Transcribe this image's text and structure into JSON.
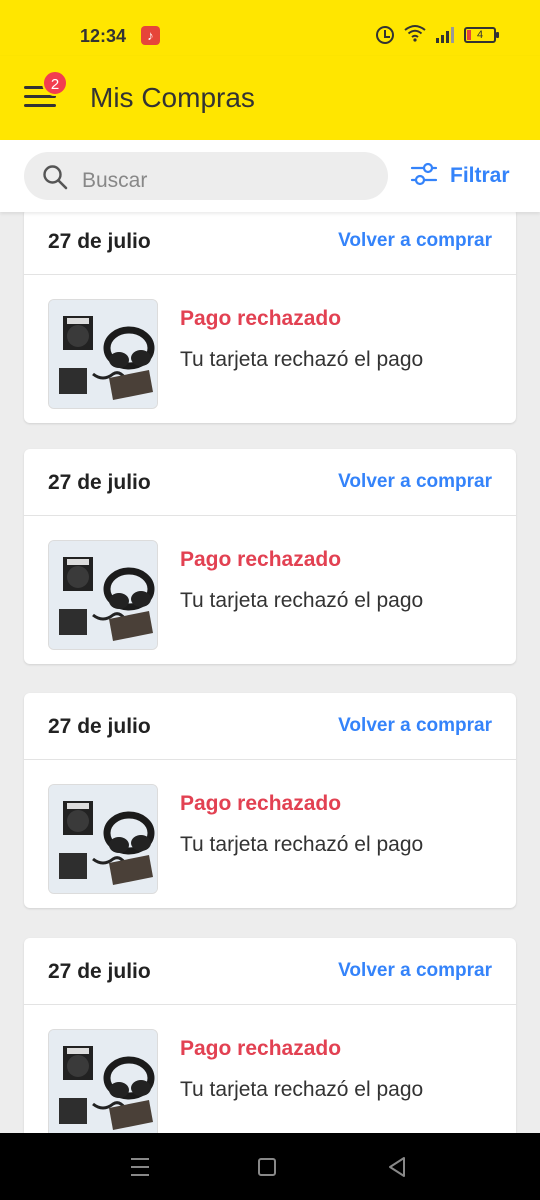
{
  "status_bar": {
    "time": "12:34",
    "battery_level": "4",
    "notification_app": "music-app-icon",
    "icons": [
      "alarm-icon",
      "wifi-icon",
      "signal-icon",
      "battery-icon"
    ]
  },
  "header": {
    "title": "Mis Compras",
    "menu_badge": "2",
    "background_color": "#ffe600"
  },
  "search": {
    "placeholder": "Buscar",
    "filter_label": "Filtrar"
  },
  "colors": {
    "accent": "#3483fa",
    "error": "#e24152"
  },
  "purchases": [
    {
      "date": "27 de julio",
      "action": "Volver a comprar",
      "status": "Pago rechazado",
      "detail": "Tu tarjeta rechazó el pago",
      "image": "headphones-product-image"
    },
    {
      "date": "27 de julio",
      "action": "Volver a comprar",
      "status": "Pago rechazado",
      "detail": "Tu tarjeta rechazó el pago",
      "image": "headphones-product-image"
    },
    {
      "date": "27 de julio",
      "action": "Volver a comprar",
      "status": "Pago rechazado",
      "detail": "Tu tarjeta rechazó el pago",
      "image": "headphones-product-image"
    },
    {
      "date": "27 de julio",
      "action": "Volver a comprar",
      "status": "Pago rechazado",
      "detail": "Tu tarjeta rechazó el pago",
      "image": "headphones-product-image"
    }
  ],
  "nav_bar": {
    "buttons": [
      "recents-icon",
      "home-icon",
      "back-icon"
    ]
  }
}
